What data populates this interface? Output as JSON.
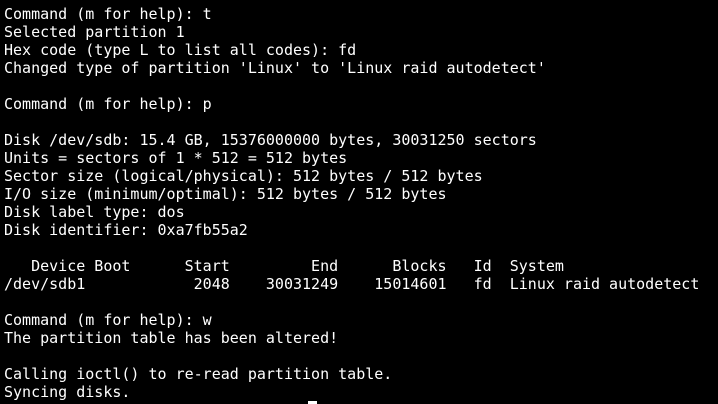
{
  "terminal": {
    "lines": [
      "Command (m for help): t",
      "Selected partition 1",
      "Hex code (type L to list all codes): fd",
      "Changed type of partition 'Linux' to 'Linux raid autodetect'",
      "",
      "Command (m for help): p",
      "",
      "Disk /dev/sdb: 15.4 GB, 15376000000 bytes, 30031250 sectors",
      "Units = sectors of 1 * 512 = 512 bytes",
      "Sector size (logical/physical): 512 bytes / 512 bytes",
      "I/O size (minimum/optimal): 512 bytes / 512 bytes",
      "Disk label type: dos",
      "Disk identifier: 0xa7fb55a2",
      "",
      "   Device Boot      Start         End      Blocks   Id  System",
      "/dev/sdb1            2048    30031249    15014601   fd  Linux raid autodetect",
      "",
      "Command (m for help): w",
      "The partition table has been altered!",
      "",
      "Calling ioctl() to re-read partition table.",
      "Syncing disks."
    ],
    "colors": {
      "background": "#000000",
      "foreground": "#ffffff"
    }
  }
}
